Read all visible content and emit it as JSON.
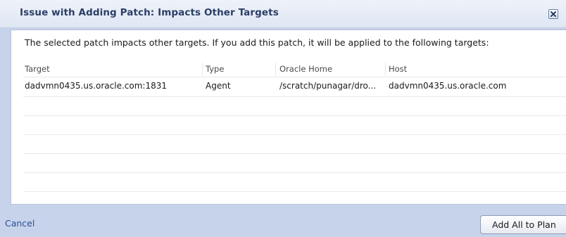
{
  "dialog": {
    "title": "Issue with Adding Patch: Impacts Other Targets",
    "message": "The selected patch impacts other targets. If you add this patch, it will be applied to the following targets:",
    "close_icon": "close-icon"
  },
  "table": {
    "columns": [
      "Target",
      "Type",
      "Oracle Home",
      "Host"
    ],
    "rows": [
      {
        "target": "dadvmn0435.us.oracle.com:1831",
        "type": "Agent",
        "oracle_home": "/scratch/punagar/dro...",
        "host": "dadvmn0435.us.oracle.com"
      }
    ]
  },
  "footer": {
    "cancel_label": "Cancel",
    "add_all_label": "Add All to Plan"
  },
  "colors": {
    "title_text": "#2c3e66",
    "link": "#2a4f9a",
    "dialog_bg": "#c7d3ea"
  }
}
